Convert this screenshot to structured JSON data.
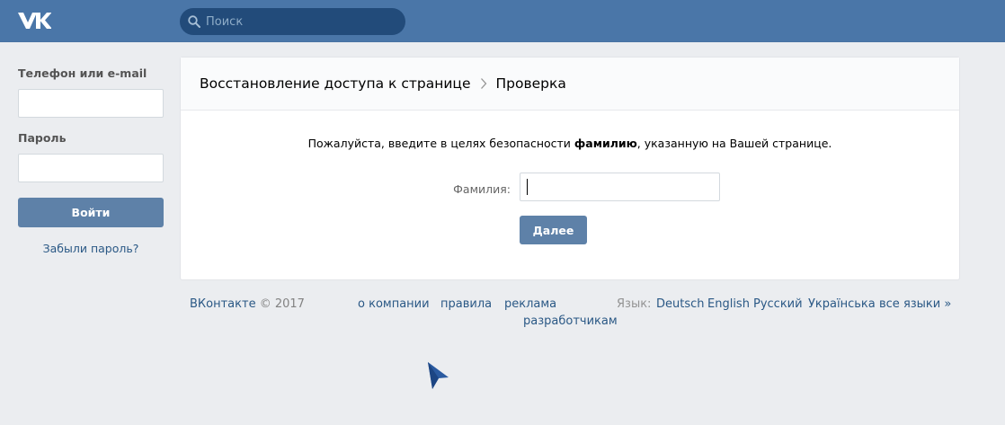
{
  "header": {
    "logo_icon": "vk-logo-icon",
    "search": {
      "placeholder": "Поиск",
      "icon": "search-icon"
    }
  },
  "sidebar": {
    "login_label": "Телефон или e-mail",
    "login_value": "",
    "password_label": "Пароль",
    "password_value": "",
    "login_button": "Войти",
    "forgot_link": "Забыли пароль?"
  },
  "main": {
    "breadcrumb": [
      "Восстановление доступа к странице",
      "Проверка"
    ],
    "breadcrumb_separator_icon": "chevron-right-icon",
    "notice_before": "Пожалуйста, введите в целях безопасности ",
    "notice_bold": "фамилию",
    "notice_after": ", указанную на Вашей странице.",
    "surname_label": "Фамилия:",
    "surname_value": "",
    "next_button": "Далее"
  },
  "footer": {
    "brand": "ВКонтакте",
    "copyright": "© 2017",
    "links": [
      "о компании",
      "правила",
      "реклама",
      "разработчикам"
    ],
    "language_label": "Язык:",
    "languages": [
      "Deutsch",
      "English",
      "Русский",
      "Українська",
      "все языки »"
    ]
  },
  "colors": {
    "header_bg": "#4a76a8",
    "search_bg": "#224b7a",
    "page_bg": "#ebedf0",
    "button_bg": "#5e81a8",
    "link": "#2a5885"
  }
}
